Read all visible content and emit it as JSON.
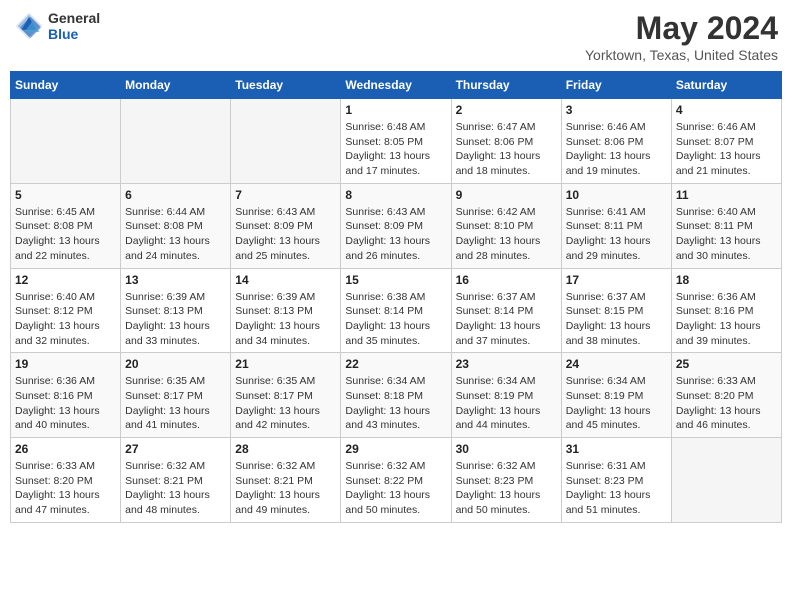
{
  "header": {
    "logo": {
      "line1": "General",
      "line2": "Blue"
    },
    "month": "May 2024",
    "location": "Yorktown, Texas, United States"
  },
  "days_of_week": [
    "Sunday",
    "Monday",
    "Tuesday",
    "Wednesday",
    "Thursday",
    "Friday",
    "Saturday"
  ],
  "weeks": [
    [
      {
        "day": "",
        "info": ""
      },
      {
        "day": "",
        "info": ""
      },
      {
        "day": "",
        "info": ""
      },
      {
        "day": "1",
        "info": "Sunrise: 6:48 AM\nSunset: 8:05 PM\nDaylight: 13 hours and 17 minutes."
      },
      {
        "day": "2",
        "info": "Sunrise: 6:47 AM\nSunset: 8:06 PM\nDaylight: 13 hours and 18 minutes."
      },
      {
        "day": "3",
        "info": "Sunrise: 6:46 AM\nSunset: 8:06 PM\nDaylight: 13 hours and 19 minutes."
      },
      {
        "day": "4",
        "info": "Sunrise: 6:46 AM\nSunset: 8:07 PM\nDaylight: 13 hours and 21 minutes."
      }
    ],
    [
      {
        "day": "5",
        "info": "Sunrise: 6:45 AM\nSunset: 8:08 PM\nDaylight: 13 hours and 22 minutes."
      },
      {
        "day": "6",
        "info": "Sunrise: 6:44 AM\nSunset: 8:08 PM\nDaylight: 13 hours and 24 minutes."
      },
      {
        "day": "7",
        "info": "Sunrise: 6:43 AM\nSunset: 8:09 PM\nDaylight: 13 hours and 25 minutes."
      },
      {
        "day": "8",
        "info": "Sunrise: 6:43 AM\nSunset: 8:09 PM\nDaylight: 13 hours and 26 minutes."
      },
      {
        "day": "9",
        "info": "Sunrise: 6:42 AM\nSunset: 8:10 PM\nDaylight: 13 hours and 28 minutes."
      },
      {
        "day": "10",
        "info": "Sunrise: 6:41 AM\nSunset: 8:11 PM\nDaylight: 13 hours and 29 minutes."
      },
      {
        "day": "11",
        "info": "Sunrise: 6:40 AM\nSunset: 8:11 PM\nDaylight: 13 hours and 30 minutes."
      }
    ],
    [
      {
        "day": "12",
        "info": "Sunrise: 6:40 AM\nSunset: 8:12 PM\nDaylight: 13 hours and 32 minutes."
      },
      {
        "day": "13",
        "info": "Sunrise: 6:39 AM\nSunset: 8:13 PM\nDaylight: 13 hours and 33 minutes."
      },
      {
        "day": "14",
        "info": "Sunrise: 6:39 AM\nSunset: 8:13 PM\nDaylight: 13 hours and 34 minutes."
      },
      {
        "day": "15",
        "info": "Sunrise: 6:38 AM\nSunset: 8:14 PM\nDaylight: 13 hours and 35 minutes."
      },
      {
        "day": "16",
        "info": "Sunrise: 6:37 AM\nSunset: 8:14 PM\nDaylight: 13 hours and 37 minutes."
      },
      {
        "day": "17",
        "info": "Sunrise: 6:37 AM\nSunset: 8:15 PM\nDaylight: 13 hours and 38 minutes."
      },
      {
        "day": "18",
        "info": "Sunrise: 6:36 AM\nSunset: 8:16 PM\nDaylight: 13 hours and 39 minutes."
      }
    ],
    [
      {
        "day": "19",
        "info": "Sunrise: 6:36 AM\nSunset: 8:16 PM\nDaylight: 13 hours and 40 minutes."
      },
      {
        "day": "20",
        "info": "Sunrise: 6:35 AM\nSunset: 8:17 PM\nDaylight: 13 hours and 41 minutes."
      },
      {
        "day": "21",
        "info": "Sunrise: 6:35 AM\nSunset: 8:17 PM\nDaylight: 13 hours and 42 minutes."
      },
      {
        "day": "22",
        "info": "Sunrise: 6:34 AM\nSunset: 8:18 PM\nDaylight: 13 hours and 43 minutes."
      },
      {
        "day": "23",
        "info": "Sunrise: 6:34 AM\nSunset: 8:19 PM\nDaylight: 13 hours and 44 minutes."
      },
      {
        "day": "24",
        "info": "Sunrise: 6:34 AM\nSunset: 8:19 PM\nDaylight: 13 hours and 45 minutes."
      },
      {
        "day": "25",
        "info": "Sunrise: 6:33 AM\nSunset: 8:20 PM\nDaylight: 13 hours and 46 minutes."
      }
    ],
    [
      {
        "day": "26",
        "info": "Sunrise: 6:33 AM\nSunset: 8:20 PM\nDaylight: 13 hours and 47 minutes."
      },
      {
        "day": "27",
        "info": "Sunrise: 6:32 AM\nSunset: 8:21 PM\nDaylight: 13 hours and 48 minutes."
      },
      {
        "day": "28",
        "info": "Sunrise: 6:32 AM\nSunset: 8:21 PM\nDaylight: 13 hours and 49 minutes."
      },
      {
        "day": "29",
        "info": "Sunrise: 6:32 AM\nSunset: 8:22 PM\nDaylight: 13 hours and 50 minutes."
      },
      {
        "day": "30",
        "info": "Sunrise: 6:32 AM\nSunset: 8:23 PM\nDaylight: 13 hours and 50 minutes."
      },
      {
        "day": "31",
        "info": "Sunrise: 6:31 AM\nSunset: 8:23 PM\nDaylight: 13 hours and 51 minutes."
      },
      {
        "day": "",
        "info": ""
      }
    ]
  ]
}
